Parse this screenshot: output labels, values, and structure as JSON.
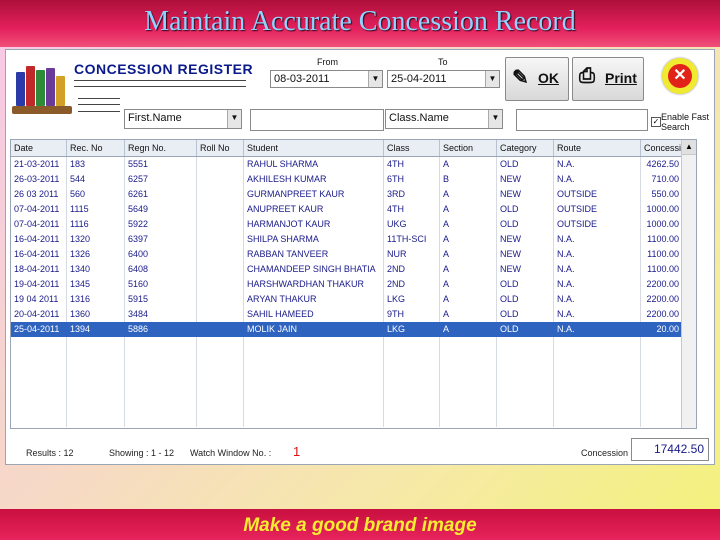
{
  "slide": {
    "title": "Maintain Accurate Concession Record",
    "footer": "Make a good brand image"
  },
  "app": {
    "register_title": "CONCESSION REGISTER",
    "from_label": "From",
    "to_label": "To",
    "from_date": "08-03-2011",
    "to_date": "25-04-2011",
    "ok_label": "OK",
    "print_label": "Print",
    "first_name_label": "First.Name",
    "class_name_label": "Class.Name",
    "enable_fast_search": "Enable Fast Search",
    "icons": {
      "books": "books-icon",
      "ok": "pencil-icon",
      "print": "printer-icon",
      "close": "close-icon"
    }
  },
  "grid": {
    "columns": [
      "Date",
      "Rec. No",
      "Regn No.",
      "Roll No",
      "Student",
      "Class",
      "Section",
      "Category",
      "Route",
      "Concession"
    ],
    "rows": [
      [
        "21-03-2011",
        "183",
        "5551",
        "",
        "RAHUL SHARMA",
        "4TH",
        "A",
        "OLD",
        "N.A.",
        "4262.50"
      ],
      [
        "26-03-2011",
        "544",
        "6257",
        "",
        "AKHILESH KUMAR",
        "6TH",
        "B",
        "NEW",
        "N.A.",
        "710.00"
      ],
      [
        "26 03 2011",
        "560",
        "6261",
        "",
        "GURMANPREET KAUR",
        "3RD",
        "A",
        "NEW",
        "OUTSIDE",
        "550.00"
      ],
      [
        "07-04-2011",
        "1115",
        "5649",
        "",
        "ANUPREET KAUR",
        "4TH",
        "A",
        "OLD",
        "OUTSIDE",
        "1000.00"
      ],
      [
        "07-04-2011",
        "1116",
        "5922",
        "",
        "HARMANJOT KAUR",
        "UKG",
        "A",
        "OLD",
        "OUTSIDE",
        "1000.00"
      ],
      [
        "16-04-2011",
        "1320",
        "6397",
        "",
        "SHILPA SHARMA",
        "11TH-SCI",
        "A",
        "NEW",
        "N.A.",
        "1100.00"
      ],
      [
        "16-04-2011",
        "1326",
        "6400",
        "",
        "RABBAN TANVEER",
        "NUR",
        "A",
        "NEW",
        "N.A.",
        "1100.00"
      ],
      [
        "18-04-2011",
        "1340",
        "6408",
        "",
        "CHAMANDEEP SINGH BHATIA",
        "2ND",
        "A",
        "NEW",
        "N.A.",
        "1100.00"
      ],
      [
        "19-04-2011",
        "1345",
        "5160",
        "",
        "HARSHWARDHAN THAKUR",
        "2ND",
        "A",
        "OLD",
        "N.A.",
        "2200.00"
      ],
      [
        "19 04 2011",
        "1316",
        "5915",
        "",
        "ARYAN THAKUR",
        "LKG",
        "A",
        "OLD",
        "N.A.",
        "2200.00"
      ],
      [
        "20-04-2011",
        "1360",
        "3484",
        "",
        "SAHIL HAMEED",
        "9TH",
        "A",
        "OLD",
        "N.A.",
        "2200.00"
      ],
      [
        "25-04-2011",
        "1394",
        "5886",
        "",
        "MOLIK JAIN",
        "LKG",
        "A",
        "OLD",
        "N.A.",
        "20.00"
      ]
    ],
    "selected_row": 11
  },
  "status": {
    "results": "Results : 12",
    "showing": "Showing :  1 - 12",
    "watch_label": "Watch Window No. :",
    "watch_value": "1",
    "total_label": "Concession",
    "total_value": "17442.50"
  },
  "colors": {
    "title_bar": "#e3205c",
    "title_text": "#8fd3ff",
    "footer_text": "#f3ee30",
    "selection": "#2f63c0"
  }
}
